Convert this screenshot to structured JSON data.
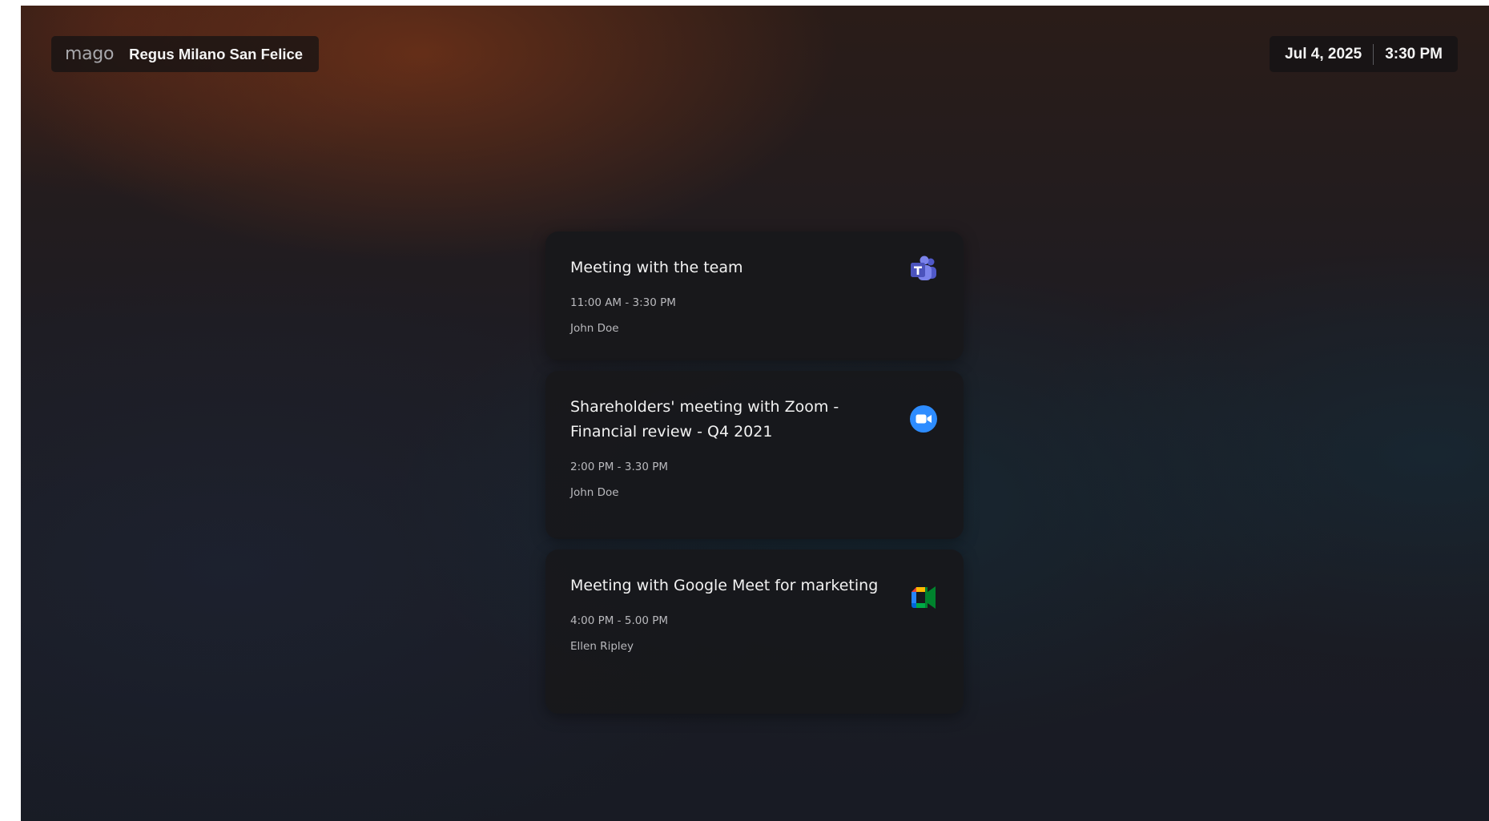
{
  "header": {
    "logo_text": "mago",
    "location": "Regus Milano San Felice",
    "date": "Jul 4, 2025",
    "time": "3:30 PM"
  },
  "meetings": [
    {
      "title": "Meeting with the team",
      "time_range": "11:00 AM - 3:30 PM",
      "organizer": "John Doe",
      "platform_icon": "microsoft-teams-icon"
    },
    {
      "title": "Shareholders' meeting with Zoom - Financial review - Q4 2021",
      "time_range": "2:00 PM - 3.30 PM",
      "organizer": "John Doe",
      "platform_icon": "zoom-icon"
    },
    {
      "title": "Meeting with Google Meet for marketing",
      "time_range": "4:00 PM - 5.00 PM",
      "organizer": "Ellen Ripley",
      "platform_icon": "google-meet-icon"
    }
  ],
  "colors": {
    "teams": "#5059c9",
    "zoom": "#2d8cff",
    "meet_green": "#00832d",
    "meet_blue": "#0066da",
    "meet_red": "#e94235",
    "meet_yellow": "#ffba00"
  }
}
